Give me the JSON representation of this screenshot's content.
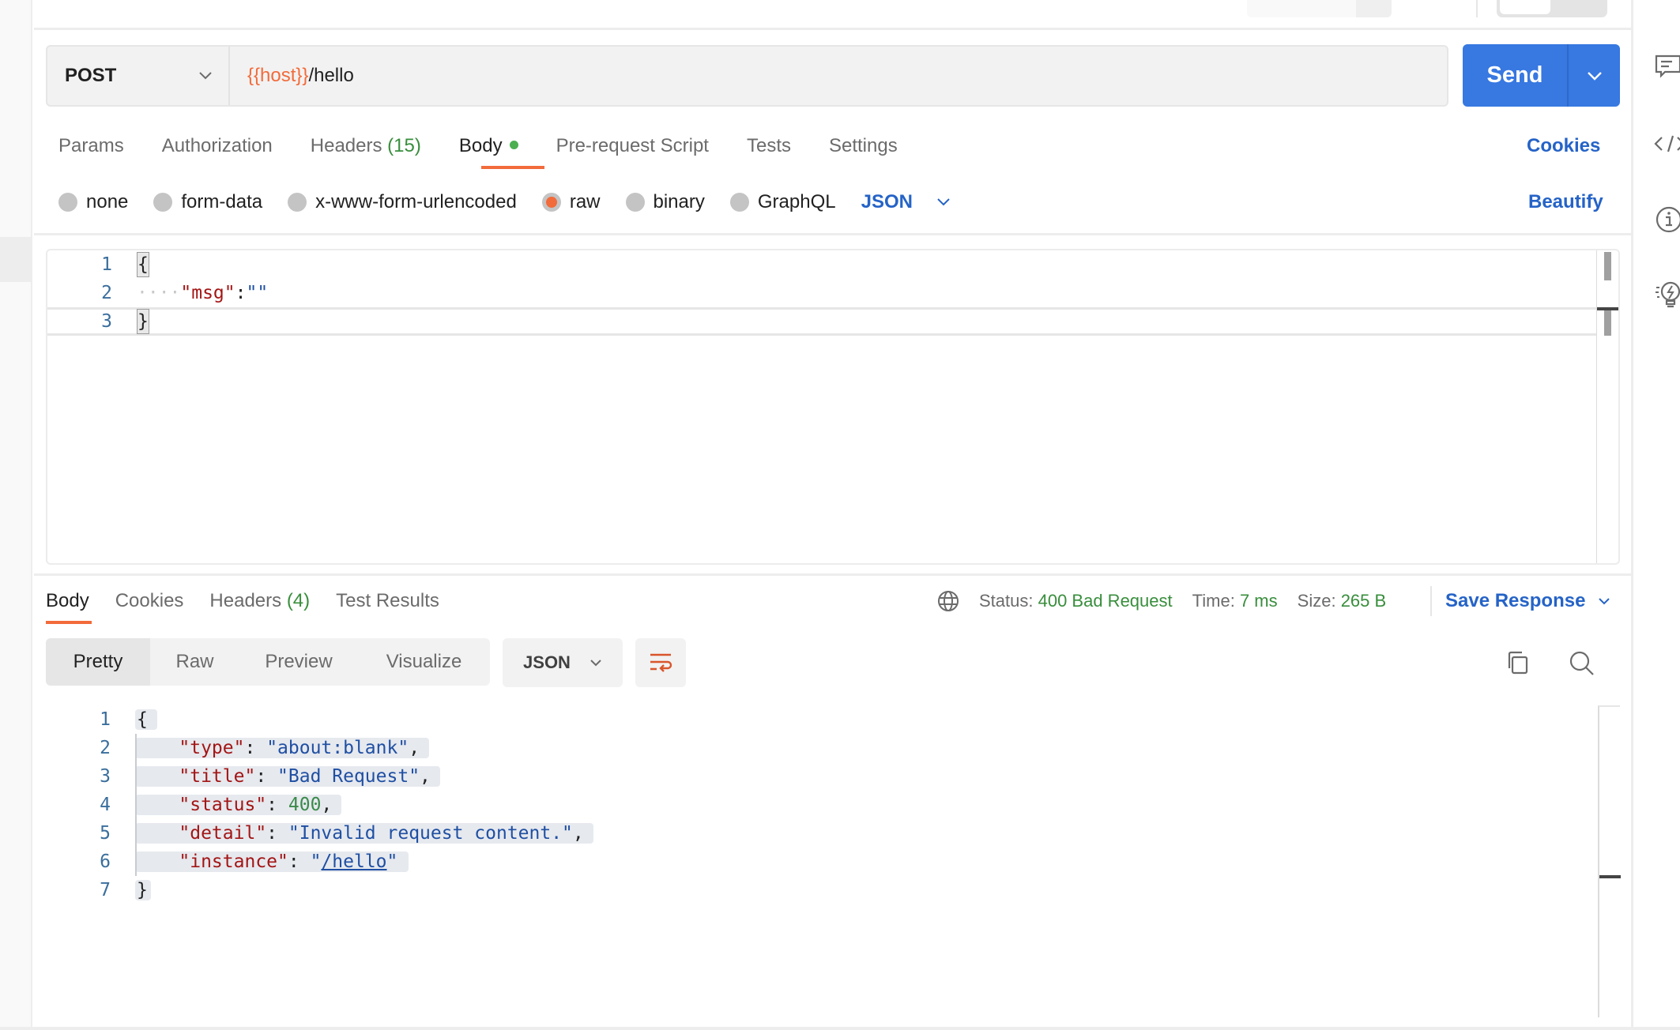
{
  "request": {
    "method": "POST",
    "url_variable": "{{host}}",
    "url_path": "/hello",
    "send_label": "Send",
    "tabs": [
      {
        "label": "Params"
      },
      {
        "label": "Authorization"
      },
      {
        "label": "Headers",
        "count": "(15)"
      },
      {
        "label": "Body",
        "active": true,
        "indicator": "green-dot"
      },
      {
        "label": "Pre-request Script"
      },
      {
        "label": "Tests"
      },
      {
        "label": "Settings"
      }
    ],
    "cookies_link": "Cookies",
    "body_types": [
      {
        "label": "none",
        "selected": false
      },
      {
        "label": "form-data",
        "selected": false
      },
      {
        "label": "x-www-form-urlencoded",
        "selected": false
      },
      {
        "label": "raw",
        "selected": true
      },
      {
        "label": "binary",
        "selected": false
      },
      {
        "label": "GraphQL",
        "selected": false
      }
    ],
    "raw_format": "JSON",
    "beautify_link": "Beautify",
    "body_lines": [
      {
        "n": "1",
        "text": "{"
      },
      {
        "n": "2",
        "key": "\"msg\"",
        "sep": ":",
        "value": "\"\""
      },
      {
        "n": "3",
        "text": "}"
      }
    ]
  },
  "response": {
    "tabs": [
      {
        "label": "Body",
        "active": true
      },
      {
        "label": "Cookies"
      },
      {
        "label": "Headers",
        "count": "(4)"
      },
      {
        "label": "Test Results"
      }
    ],
    "status_label": "Status:",
    "status_value": "400 Bad Request",
    "time_label": "Time:",
    "time_value": "7 ms",
    "size_label": "Size:",
    "size_value": "265 B",
    "save_response": "Save Response",
    "view_modes": [
      "Pretty",
      "Raw",
      "Preview",
      "Visualize"
    ],
    "active_view": "Pretty",
    "format": "JSON",
    "lines": [
      {
        "n": "1",
        "text": "{"
      },
      {
        "n": "2",
        "key": "\"type\"",
        "value": "\"about:blank\"",
        "comma": ","
      },
      {
        "n": "3",
        "key": "\"title\"",
        "value": "\"Bad Request\"",
        "comma": ","
      },
      {
        "n": "4",
        "key": "\"status\"",
        "value": "400",
        "comma": ","
      },
      {
        "n": "5",
        "key": "\"detail\"",
        "value": "\"Invalid request content.\"",
        "comma": ","
      },
      {
        "n": "6",
        "key": "\"instance\"",
        "value_q1": "\"",
        "value_link": "/hello",
        "value_q2": "\""
      },
      {
        "n": "7",
        "text": "}"
      }
    ]
  },
  "colors": {
    "accent": "#f26b3a",
    "send_blue": "#3778e1",
    "link_blue": "#2563c7",
    "success_green": "#388e3c"
  },
  "right_sidebar_icons": [
    "comments-icon",
    "code-icon",
    "info-icon",
    "lightbulb-icon"
  ]
}
